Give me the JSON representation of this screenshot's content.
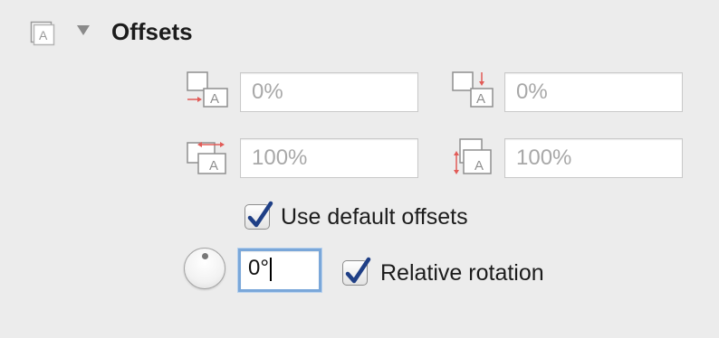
{
  "section": {
    "title": "Offsets",
    "expanded": true
  },
  "offsets": {
    "horizontal": {
      "value": "0%"
    },
    "vertical": {
      "value": "0%"
    },
    "width": {
      "value": "100%"
    },
    "height": {
      "value": "100%"
    }
  },
  "use_default_offsets": {
    "label": "Use default offsets",
    "checked": true
  },
  "rotation": {
    "value": "0°"
  },
  "relative_rotation": {
    "label": "Relative rotation",
    "checked": true
  },
  "colors": {
    "accent_check": "#1f3f86",
    "focus_ring": "#7aa7d9",
    "arrow_red": "#e25b57"
  }
}
